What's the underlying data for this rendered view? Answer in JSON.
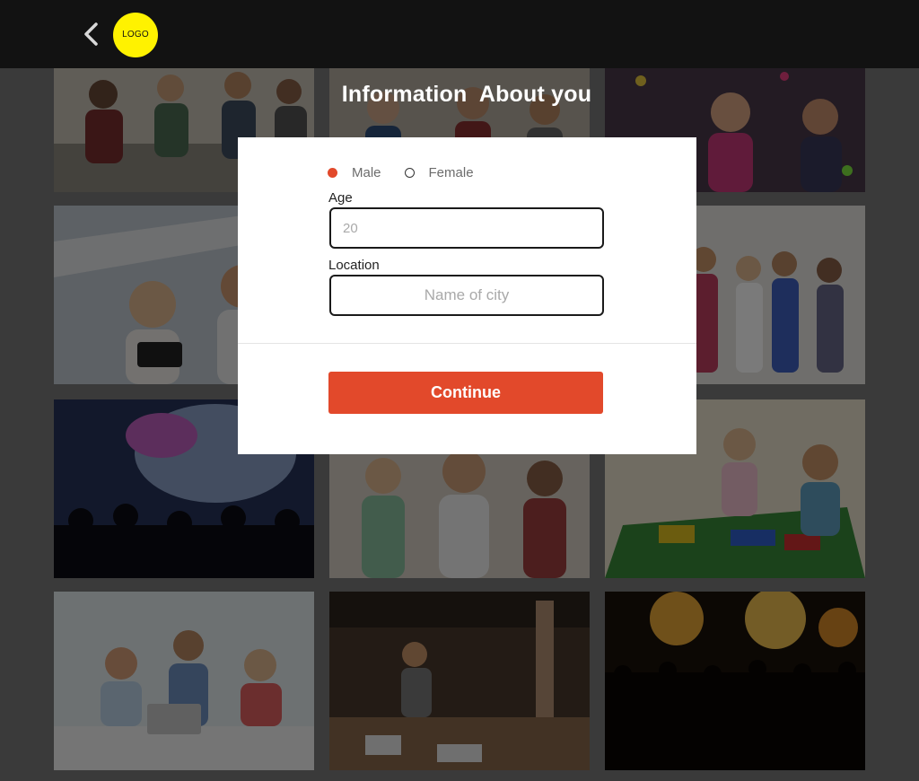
{
  "header": {
    "back_icon": "chevron-left-icon",
    "logo_text": "LOGO",
    "logo_color": "#fff200",
    "background": "#121212"
  },
  "form": {
    "title": "Information  About you",
    "gender": {
      "options": [
        "Male",
        "Female"
      ],
      "selected": "Male"
    },
    "age_label": "Age",
    "age_placeholder": "20",
    "location_label": "Location",
    "location_placeholder": "Name of city",
    "continue_label": "Continue"
  },
  "colors": {
    "accent": "#e2492b",
    "modal_background": "#ffffff"
  },
  "background_photos": [
    "group of friends sitting together",
    "party",
    "celebration with confetti",
    "friends taking selfie",
    "party crowd",
    "group of students",
    "concert crowd",
    "people at party",
    "children doing crafts",
    "office team meeting",
    "coworking office",
    "concert stage"
  ]
}
